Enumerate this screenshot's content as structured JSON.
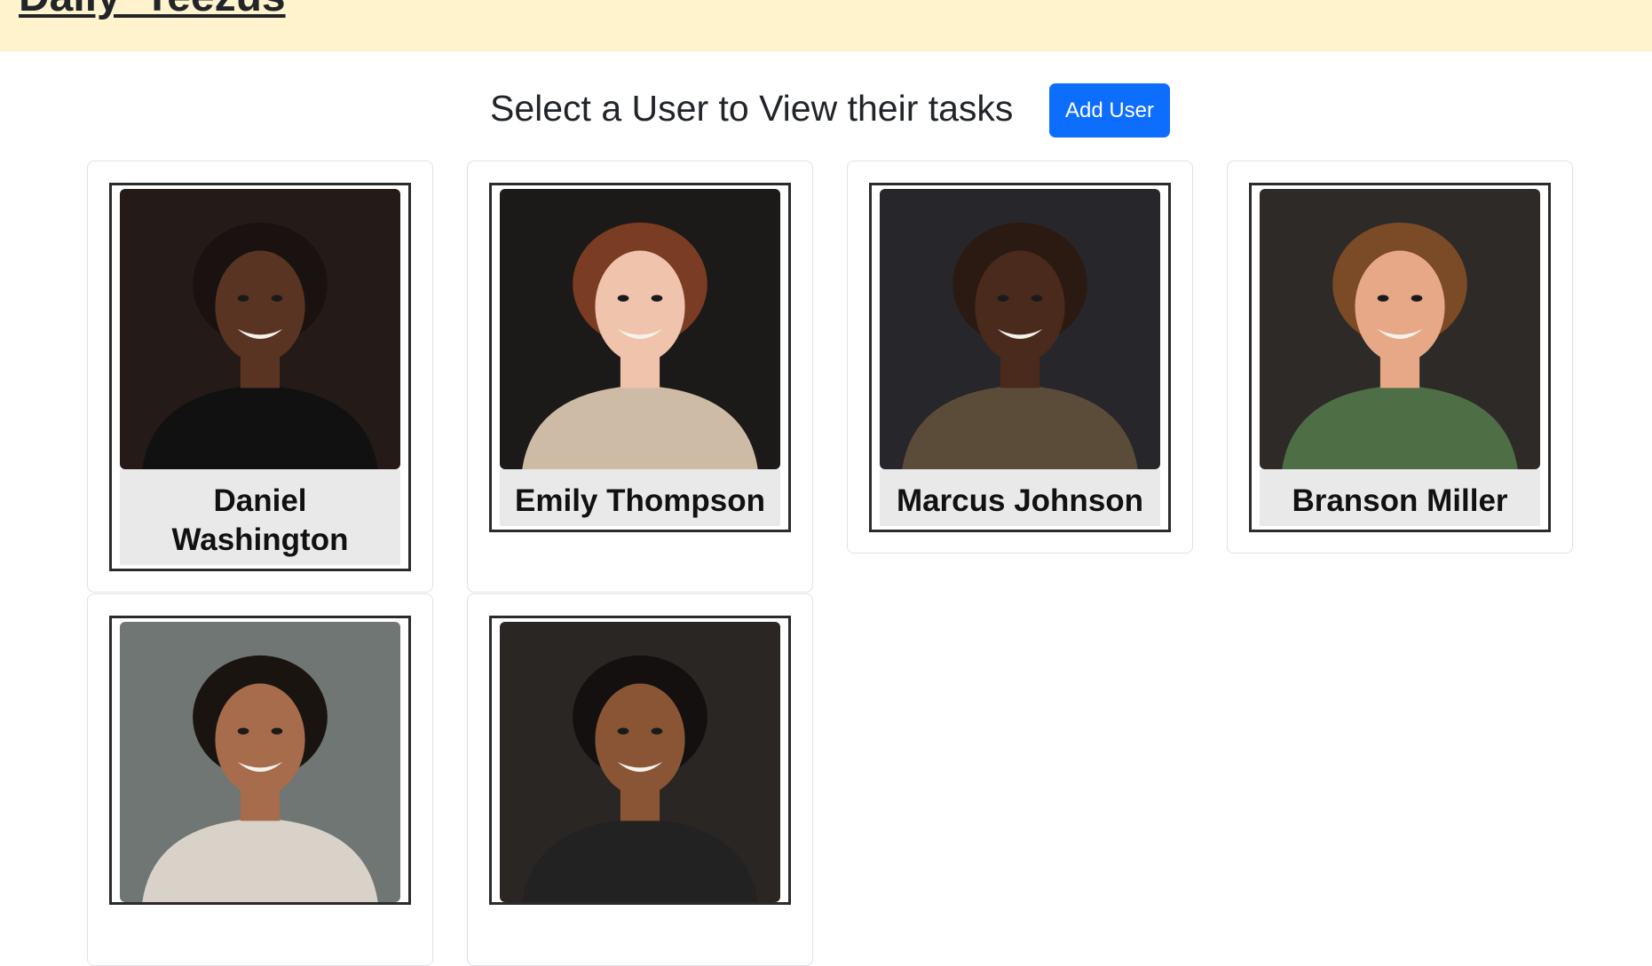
{
  "header": {
    "brand": "Daily_Teezus"
  },
  "main": {
    "title": "Select a User to View their tasks",
    "add_user_label": "Add User"
  },
  "users": [
    {
      "name": "Daniel Washington",
      "bg": "#241a17",
      "skin": "#5a3422",
      "hair": "#1a1210",
      "shirt": "#111111"
    },
    {
      "name": "Emily Thompson",
      "bg": "#1c1a19",
      "skin": "#f0c3ad",
      "hair": "#7a3c22",
      "shirt": "#cdbba6"
    },
    {
      "name": "Marcus Johnson",
      "bg": "#27262a",
      "skin": "#4a2a1c",
      "hair": "#2b1a12",
      "shirt": "#5b4b39"
    },
    {
      "name": "Branson Miller",
      "bg": "#2d2a28",
      "skin": "#e7a888",
      "hair": "#7b4a26",
      "shirt": "#4e6e46"
    },
    {
      "name": "",
      "bg": "#6f7673",
      "skin": "#a66c4c",
      "hair": "#1a1411",
      "shirt": "#d8d2c8"
    },
    {
      "name": "",
      "bg": "#2a2624",
      "skin": "#8a5535",
      "hair": "#141010",
      "shirt": "#222222"
    }
  ]
}
